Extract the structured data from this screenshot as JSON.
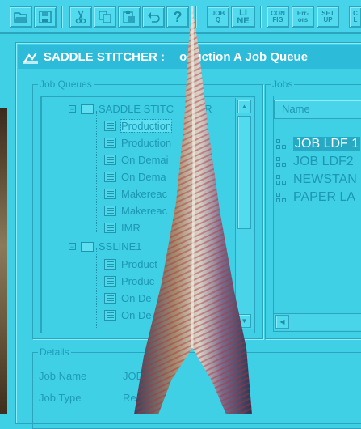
{
  "toolbar": {
    "buttons": [
      {
        "name": "open-button",
        "icon": "folder-open-icon"
      },
      {
        "name": "save-button",
        "icon": "floppy-disk-icon"
      },
      {
        "name": "cut-button",
        "icon": "scissors-icon"
      },
      {
        "name": "copy-button",
        "icon": "copy-icon"
      },
      {
        "name": "paste-button",
        "icon": "clipboard-icon"
      },
      {
        "name": "undo-button",
        "icon": "undo-arrow-icon"
      },
      {
        "name": "help-button",
        "icon": "question-mark-icon"
      }
    ],
    "text_buttons": [
      {
        "name": "job-queue-button",
        "label_top": "JOB",
        "label_bottom": "Q"
      },
      {
        "name": "line-button",
        "label_top": "LI",
        "label_bottom": "NE"
      },
      {
        "name": "config-button",
        "label_top": "CON",
        "label_bottom": "FIG"
      },
      {
        "name": "errors-button",
        "label_top": "Err-",
        "label_bottom": "ors"
      },
      {
        "name": "setup-button",
        "label_top": "SET",
        "label_bottom": "UP"
      },
      {
        "name": "cut-off-button",
        "label_top": "C",
        "label_bottom": "L"
      }
    ]
  },
  "window": {
    "title": "SADDLE STITCHER : Production A Job Queue",
    "title_visible_left": "SADDLE STITCHER : ",
    "title_visible_right": "oduction A Job Queue"
  },
  "job_queues": {
    "legend": "Job Queues",
    "tree": [
      {
        "type": "station",
        "label": "SADDLE STITCHER",
        "shown": "SADDLE STITC",
        "suffix": "R"
      },
      {
        "type": "queue",
        "label": "Production",
        "selected": true
      },
      {
        "type": "queue",
        "label": "Production"
      },
      {
        "type": "queue",
        "label": "On Demai"
      },
      {
        "type": "queue",
        "label": "On Dema"
      },
      {
        "type": "queue",
        "label": "Makereac"
      },
      {
        "type": "queue",
        "label": "Makereac"
      },
      {
        "type": "queue",
        "label": "IMR"
      },
      {
        "type": "station",
        "label": "SSLINE1"
      },
      {
        "type": "queue",
        "label": "Product"
      },
      {
        "type": "queue",
        "label": "Produc"
      },
      {
        "type": "queue",
        "label": "On De"
      },
      {
        "type": "queue",
        "label": "On De"
      }
    ]
  },
  "jobs": {
    "legend": "Jobs",
    "column_header": "Name",
    "items": [
      {
        "label": "JOB LDF 1",
        "selected": true
      },
      {
        "label": "JOB LDF2"
      },
      {
        "label": "NEWSTAN"
      },
      {
        "label": "PAPER LA"
      }
    ]
  },
  "details": {
    "legend": "Details",
    "fields": [
      {
        "label": "Job Name",
        "value": "JOB"
      },
      {
        "label": "Job Type",
        "value": "Re"
      }
    ]
  },
  "colors": {
    "background": "#3fd0e6",
    "titlebar": "#2cbcd9",
    "text": "#1d97b2",
    "selection": "#27a9c4"
  }
}
